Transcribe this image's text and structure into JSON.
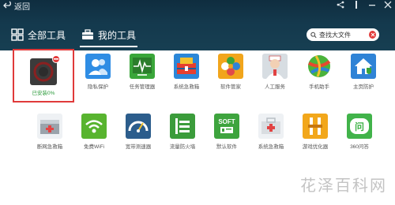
{
  "header": {
    "back_label": "返回",
    "tabs": [
      {
        "label": "全部工具"
      },
      {
        "label": "我的工具"
      }
    ],
    "search": {
      "placeholder": "查找大文件"
    }
  },
  "tools_row1": [
    {
      "label": "已安装0%",
      "icon": "progress-ring-icon",
      "color": "#3b3b3b"
    },
    {
      "label": "隐私保护",
      "icon": "users-icon",
      "color": "#2f8de4"
    },
    {
      "label": "任务管理器",
      "icon": "waveform-icon",
      "color": "#3aa63a"
    },
    {
      "label": "系统急救箱",
      "icon": "toolbox-icon",
      "color": "#2b87d8"
    },
    {
      "label": "软件管家",
      "icon": "flower-icon",
      "color": "#f1a51c"
    },
    {
      "label": "人工服务",
      "icon": "doctor-icon",
      "color": "#d7dde2"
    },
    {
      "label": "手机助手",
      "icon": "ball-icon",
      "color": "#4bb33b"
    },
    {
      "label": "主页防护",
      "icon": "home-shield-icon",
      "color": "#2f83d6"
    }
  ],
  "tools_row2": [
    {
      "label": "断网急救箱",
      "icon": "firstaid-box-icon",
      "color": "#9aa3ab"
    },
    {
      "label": "免费WiFi",
      "icon": "wifi-icon",
      "color": "#58b42f"
    },
    {
      "label": "宽带测速器",
      "icon": "speedometer-icon",
      "color": "#2c5d8c"
    },
    {
      "label": "流量防火墙",
      "icon": "firewall-icon",
      "color": "#3b9c3b"
    },
    {
      "label": "默认软件",
      "icon": "soft-icon",
      "color": "#3ea43e",
      "icon_text": "SOFT"
    },
    {
      "label": "系统急救箱",
      "icon": "medkit-icon",
      "color": "#d9dde1"
    },
    {
      "label": "游戏优化器",
      "icon": "game-icon",
      "color": "#f2a71b"
    },
    {
      "label": "360问答",
      "icon": "question-bubble-icon",
      "color": "#41b34a",
      "icon_text": "问"
    }
  ],
  "watermark": "花泽百科网"
}
